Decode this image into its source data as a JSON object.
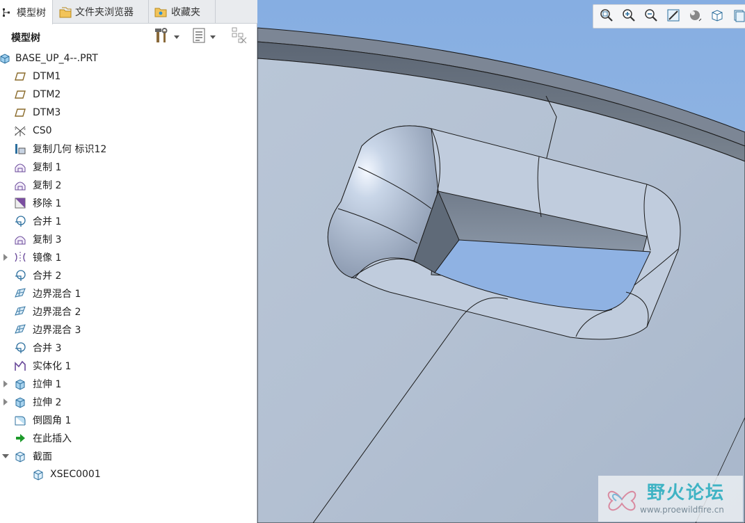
{
  "tabs": [
    {
      "label": "模型树",
      "icon": "model-tree-icon"
    },
    {
      "label": "文件夹浏览器",
      "icon": "folder-browser-icon"
    },
    {
      "label": "收藏夹",
      "icon": "favorites-icon"
    }
  ],
  "tree_header": {
    "title": "模型树"
  },
  "tree": [
    {
      "label": "BASE_UP_4--.PRT",
      "icon": "part-icon",
      "indent": 0,
      "expand": ""
    },
    {
      "label": "DTM1",
      "icon": "datum-plane-icon",
      "indent": 1,
      "expand": ""
    },
    {
      "label": "DTM2",
      "icon": "datum-plane-icon",
      "indent": 1,
      "expand": ""
    },
    {
      "label": "DTM3",
      "icon": "datum-plane-icon",
      "indent": 1,
      "expand": ""
    },
    {
      "label": "CS0",
      "icon": "coordinate-system-icon",
      "indent": 1,
      "expand": ""
    },
    {
      "label": "复制几何 标识12",
      "icon": "copy-geometry-icon",
      "indent": 1,
      "expand": ""
    },
    {
      "label": "复制 1",
      "icon": "copy-surface-icon",
      "indent": 1,
      "expand": ""
    },
    {
      "label": "复制 2",
      "icon": "copy-surface-icon",
      "indent": 1,
      "expand": ""
    },
    {
      "label": "移除 1",
      "icon": "remove-icon",
      "indent": 1,
      "expand": ""
    },
    {
      "label": "合并 1",
      "icon": "merge-icon",
      "indent": 1,
      "expand": ""
    },
    {
      "label": "复制 3",
      "icon": "copy-surface-icon",
      "indent": 1,
      "expand": ""
    },
    {
      "label": "镜像 1",
      "icon": "mirror-icon",
      "indent": 1,
      "expand": "collapsed"
    },
    {
      "label": "合并 2",
      "icon": "merge-icon",
      "indent": 1,
      "expand": ""
    },
    {
      "label": "边界混合 1",
      "icon": "boundary-blend-icon",
      "indent": 1,
      "expand": ""
    },
    {
      "label": "边界混合 2",
      "icon": "boundary-blend-icon",
      "indent": 1,
      "expand": ""
    },
    {
      "label": "边界混合 3",
      "icon": "boundary-blend-icon",
      "indent": 1,
      "expand": ""
    },
    {
      "label": "合并 3",
      "icon": "merge-icon",
      "indent": 1,
      "expand": ""
    },
    {
      "label": "实体化 1",
      "icon": "solidify-icon",
      "indent": 1,
      "expand": ""
    },
    {
      "label": "拉伸 1",
      "icon": "extrude-icon",
      "indent": 1,
      "expand": "collapsed"
    },
    {
      "label": "拉伸 2",
      "icon": "extrude-icon",
      "indent": 1,
      "expand": "collapsed"
    },
    {
      "label": "倒圆角 1",
      "icon": "round-icon",
      "indent": 1,
      "expand": ""
    },
    {
      "label": "在此插入",
      "icon": "insert-here-arrow-icon",
      "indent": 1,
      "expand": ""
    },
    {
      "label": "截面",
      "icon": "section-folder-icon",
      "indent": 1,
      "expand": "expanded"
    },
    {
      "label": "XSEC0001",
      "icon": "section-icon",
      "indent": 2,
      "expand": ""
    }
  ],
  "view_toolbar": [
    {
      "icon": "zoom-fit-icon"
    },
    {
      "icon": "zoom-in-icon"
    },
    {
      "icon": "zoom-out-icon"
    },
    {
      "icon": "repaint-icon"
    },
    {
      "icon": "display-style-icon"
    },
    {
      "icon": "saved-views-icon"
    },
    {
      "icon": "view-manager-icon"
    }
  ],
  "watermark": {
    "title": "野火论坛",
    "url": "www.proewildfire.cn"
  },
  "colors": {
    "background": "#8db0de",
    "model": "#b4c1d4",
    "accent": "#3fb3c4"
  }
}
